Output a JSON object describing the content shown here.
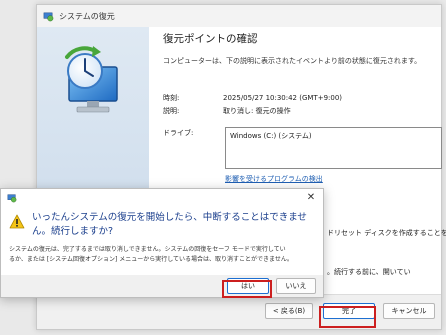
{
  "window": {
    "title": "システムの復元",
    "heading": "復元ポイントの確認",
    "description": "コンピューターは、下の説明に表示されたイベントより前の状態に復元されます。",
    "time_label": "時刻:",
    "time_value": "2025/05/27 10:30:42 (GMT+9:00)",
    "desc_label": "説明:",
    "desc_value": "取り消し: 復元の操作",
    "drive_label": "ドライブ:",
    "drive_value": "Windows (C:) (システム)",
    "scan_link": "影響を受けるプログラムの検出",
    "fragment_1": "ドリセット ディスクを作成することを",
    "fragment_2": "。続行する前に、開いてい",
    "back_button": "< 戻る(B)",
    "finish_button": "完了",
    "cancel_button": "キャンセル"
  },
  "dialog": {
    "message": "いったんシステムの復元を開始したら、中断することはできません。続行しますか?",
    "detail_line1": "システムの復元は、完了するまでは取り消しできません。システムの回復をセーフ モードで実行してい",
    "detail_line2": "るか、または [システム回復オプション] メニューから実行している場合は、取り消すことができません。",
    "yes_button": "はい",
    "no_button": "いいえ"
  },
  "colors": {
    "highlight": "#cc1f1f",
    "link": "#1f5fb3",
    "dialog_text": "#1a3e8c"
  }
}
